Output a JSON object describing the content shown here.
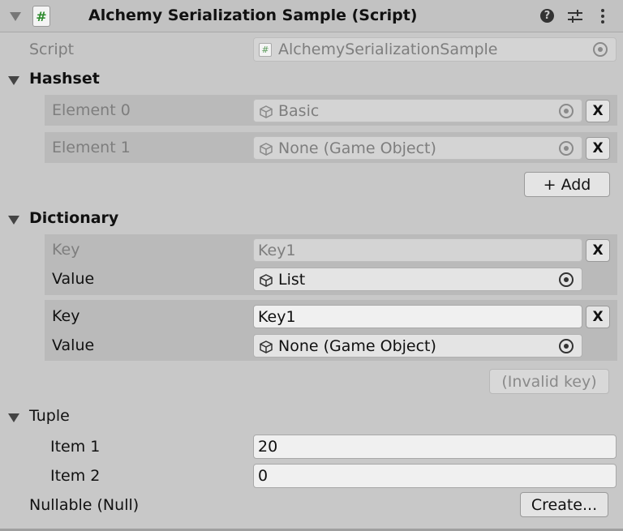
{
  "header": {
    "title": "Alchemy Serialization Sample (Script)",
    "script_glyph": "#",
    "icons": [
      "help-icon",
      "preset-sliders-icon",
      "more-vert-icon"
    ]
  },
  "script_field": {
    "label": "Script",
    "value": "AlchemySerializationSample"
  },
  "hashset": {
    "title": "Hashset",
    "elements": [
      {
        "label": "Element 0",
        "value": "Basic"
      },
      {
        "label": "Element 1",
        "value": "None (Game Object)"
      }
    ],
    "add_label": "+ Add",
    "remove_label": "X"
  },
  "dictionary": {
    "title": "Dictionary",
    "entries": [
      {
        "key_label": "Key",
        "key": "Key1",
        "value_label": "Value",
        "value": "List"
      },
      {
        "key_label": "Key",
        "key": "Key1",
        "value_label": "Value",
        "value": "None (Game Object)"
      }
    ],
    "invalid_label": "(Invalid key)"
  },
  "tuple": {
    "title": "Tuple",
    "items": [
      {
        "label": "Item 1",
        "value": "20"
      },
      {
        "label": "Item 2",
        "value": "0"
      }
    ]
  },
  "nullable": {
    "label": "Nullable (Null)",
    "button": "Create..."
  }
}
